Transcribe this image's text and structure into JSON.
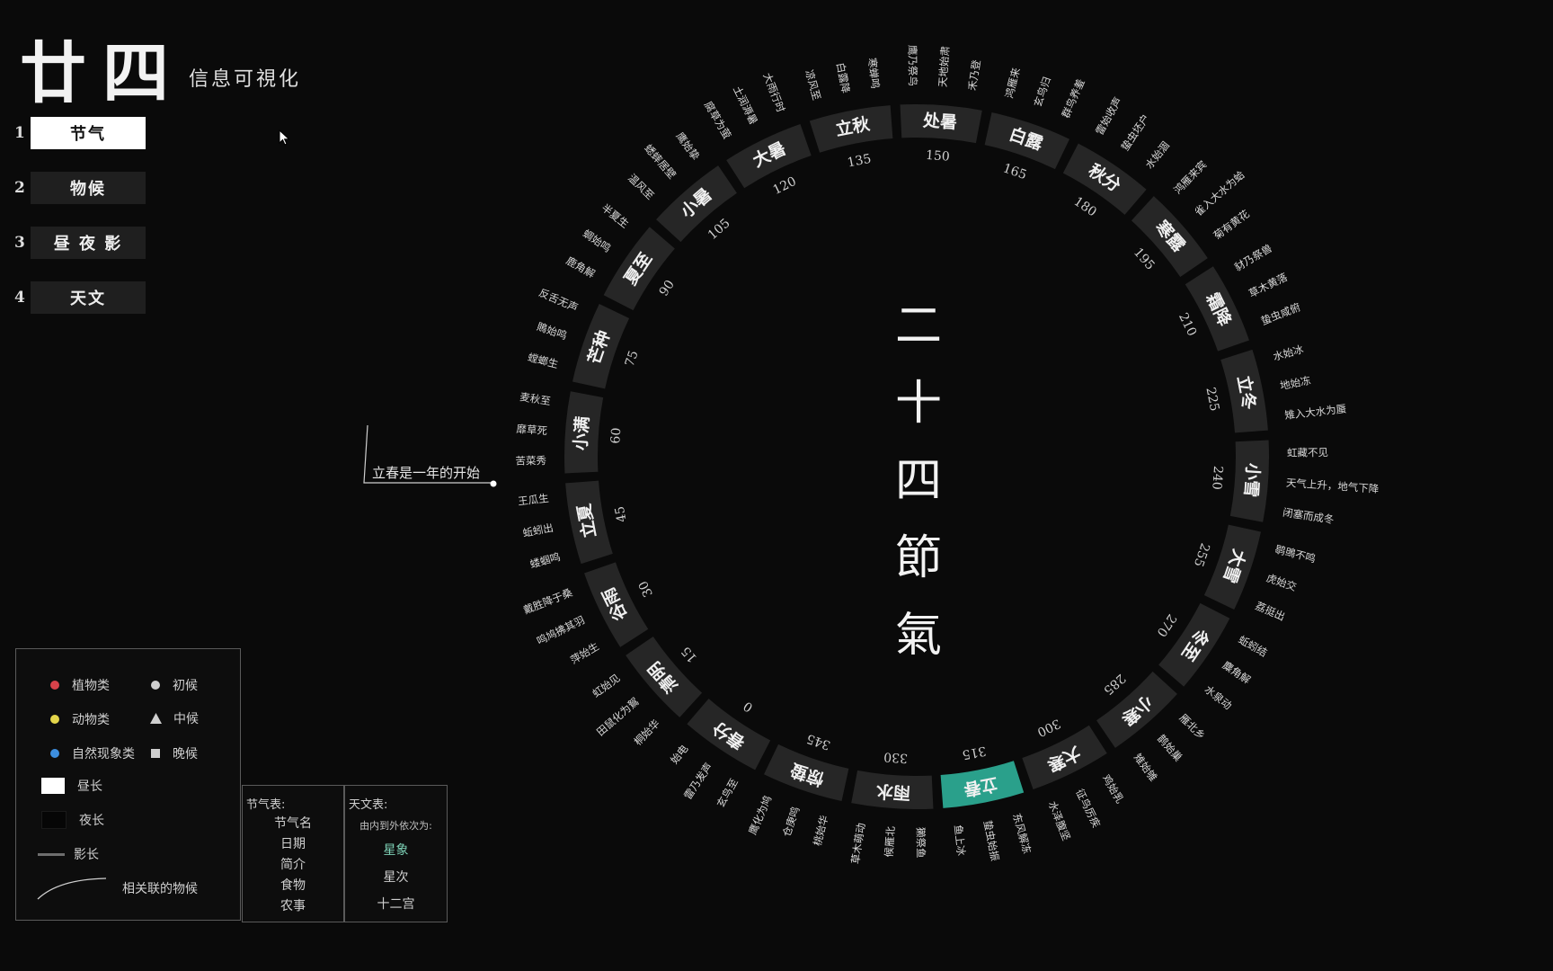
{
  "header": {
    "title": "廿四",
    "subtitle": "信息可視化"
  },
  "menu": [
    {
      "num": "1",
      "label": "节气",
      "active": true
    },
    {
      "num": "2",
      "label": "物候",
      "active": false
    },
    {
      "num": "3",
      "label": "昼 夜 影",
      "active": false
    },
    {
      "num": "4",
      "label": "天文",
      "active": false
    }
  ],
  "center_title": [
    "二",
    "十",
    "四",
    "節",
    "氣"
  ],
  "callout": {
    "text": "立春是一年的开始"
  },
  "colors": {
    "accent": "#2aa08b",
    "plant": "#d9424a",
    "animal": "#e3d54a",
    "nature": "#3d8fe0",
    "segment": "#262626"
  },
  "legend": {
    "plant": "植物类",
    "initial": "初候",
    "animal": "动物类",
    "middle": "中候",
    "nature": "自然现象类",
    "late": "晚候",
    "day": "昼长",
    "night": "夜长",
    "shadow": "影长",
    "related": "相关联的物候"
  },
  "table_a": {
    "title": "节气表:",
    "rows": [
      "节气名",
      "日期",
      "简介",
      "食物",
      "农事"
    ]
  },
  "table_b": {
    "title": "天文表:",
    "sub": "由内到外依次为:",
    "rows": [
      "星象",
      "星次",
      "十二宫"
    ]
  },
  "wheel": {
    "terms": [
      {
        "name": "立春",
        "deg": 315
      },
      {
        "name": "雨水",
        "deg": 330
      },
      {
        "name": "惊蛰",
        "deg": 345
      },
      {
        "name": "春分",
        "deg": 0
      },
      {
        "name": "清明",
        "deg": 15
      },
      {
        "name": "谷雨",
        "deg": 30
      },
      {
        "name": "立夏",
        "deg": 45
      },
      {
        "name": "小满",
        "deg": 60
      },
      {
        "name": "芒种",
        "deg": 75
      },
      {
        "name": "夏至",
        "deg": 90
      },
      {
        "name": "小暑",
        "deg": 105
      },
      {
        "name": "大暑",
        "deg": 120
      },
      {
        "name": "立秋",
        "deg": 135
      },
      {
        "name": "处暑",
        "deg": 150
      },
      {
        "name": "白露",
        "deg": 165
      },
      {
        "name": "秋分",
        "deg": 180
      },
      {
        "name": "寒露",
        "deg": 195
      },
      {
        "name": "霜降",
        "deg": 210
      },
      {
        "name": "立冬",
        "deg": 225
      },
      {
        "name": "小雪",
        "deg": 240
      },
      {
        "name": "大雪",
        "deg": 255
      },
      {
        "name": "冬至",
        "deg": 270
      },
      {
        "name": "小寒",
        "deg": 285
      },
      {
        "name": "大寒",
        "deg": 300
      }
    ],
    "selected": "立春",
    "phenology": [
      "东风解冻",
      "蛰虫始振",
      "鱼上冰",
      "獭祭鱼",
      "候雁北",
      "草木萌动",
      "桃始华",
      "仓庚鸣",
      "鹰化为鸠",
      "玄鸟至",
      "雷乃发声",
      "始电",
      "桐始华",
      "田鼠化为鴽",
      "虹始见",
      "萍始生",
      "鸣鸠拂其羽",
      "戴胜降于桑",
      "蝼蝈鸣",
      "蚯蚓出",
      "王瓜生",
      "苦菜秀",
      "靡草死",
      "麦秋至",
      "螳螂生",
      "鵙始鸣",
      "反舌无声",
      "鹿角解",
      "蜩始鸣",
      "半夏生",
      "温风至",
      "蟋蟀居壁",
      "鹰始挚",
      "腐草为萤",
      "土润溽暑",
      "大雨行时",
      "凉风至",
      "白露降",
      "寒蝉鸣",
      "鹰乃祭鸟",
      "天地始肃",
      "禾乃登",
      "鸿雁来",
      "玄鸟归",
      "群鸟养羞",
      "雷始收声",
      "蛰虫坯户",
      "水始涸",
      "鸿雁来宾",
      "雀入大水为蛤",
      "菊有黄花",
      "豺乃祭兽",
      "草木黄落",
      "蛰虫咸俯",
      "水始冰",
      "地始冻",
      "雉入大水为蜃",
      "虹藏不见",
      "天气上升，地气下降",
      "闭塞而成冬",
      "鹖鴠不鸣",
      "虎始交",
      "荔挺出",
      "蚯蚓结",
      "麋角解",
      "水泉动",
      "雁北乡",
      "鹊始巢",
      "雉始雊",
      "鸡始乳",
      "征鸟厉疾",
      "水泽腹坚"
    ]
  }
}
